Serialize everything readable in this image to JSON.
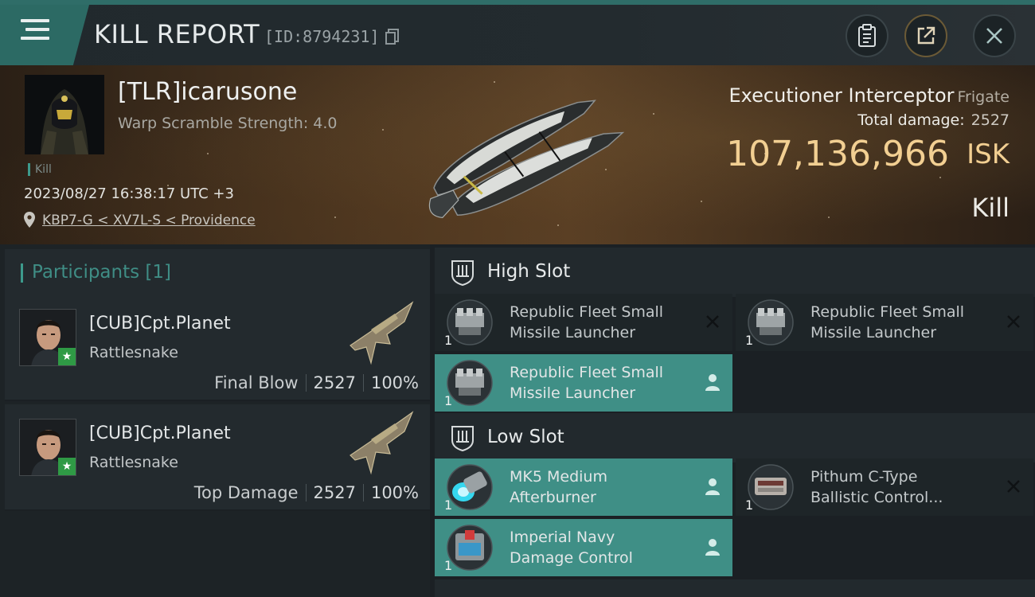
{
  "header": {
    "title": "KILL REPORT",
    "report_id": "[ID:8794231]",
    "icons": [
      "menu-icon",
      "copy-icon",
      "clipboard-icon",
      "share-icon",
      "close-icon"
    ]
  },
  "victim": {
    "name": "[TLR]icarusone",
    "warp_scramble": "Warp Scramble Strength: 4.0",
    "tag": "Kill",
    "timestamp": "2023/08/27 16:38:17 UTC +3",
    "location": "KBP7-G < XV7L-S < Providence",
    "ship_name": "Executioner Interceptor",
    "ship_class": "Frigate",
    "total_damage_label": "Total damage:",
    "total_damage": "2527",
    "isk_value": "107,136,966",
    "isk_unit": "ISK",
    "result": "Kill"
  },
  "participants": {
    "title": "Participants [1]",
    "rows": [
      {
        "name": "[CUB]Cpt.Planet",
        "ship": "Rattlesnake",
        "role": "Final Blow",
        "damage": "2527",
        "percent": "100%"
      },
      {
        "name": "[CUB]Cpt.Planet",
        "ship": "Rattlesnake",
        "role": "Top Damage",
        "damage": "2527",
        "percent": "100%"
      }
    ]
  },
  "fitting": {
    "high_slot": {
      "label": "High Slot",
      "modules": [
        {
          "name_line1": "Republic Fleet Small",
          "name_line2": "Missile Launcher",
          "qty": "1",
          "status": "destroyed",
          "highlighted": false
        },
        {
          "name_line1": "Republic Fleet Small",
          "name_line2": "Missile Launcher",
          "qty": "1",
          "status": "destroyed",
          "highlighted": false
        },
        {
          "name_line1": "Republic Fleet Small",
          "name_line2": "Missile Launcher",
          "qty": "1",
          "status": "dropped",
          "highlighted": true
        }
      ]
    },
    "low_slot": {
      "label": "Low Slot",
      "modules": [
        {
          "name_line1": "MK5 Medium",
          "name_line2": "Afterburner",
          "qty": "1",
          "status": "dropped",
          "highlighted": true
        },
        {
          "name_line1": "Pithum C-Type",
          "name_line2": "Ballistic Control...",
          "qty": "1",
          "status": "destroyed",
          "highlighted": false
        },
        {
          "name_line1": "Imperial Navy",
          "name_line2": "Damage Control",
          "qty": "1",
          "status": "dropped",
          "highlighted": true
        }
      ]
    }
  },
  "colors": {
    "accent": "#3f8f86",
    "isk": "#f2cf92",
    "header_tab": "#2c6a64"
  }
}
